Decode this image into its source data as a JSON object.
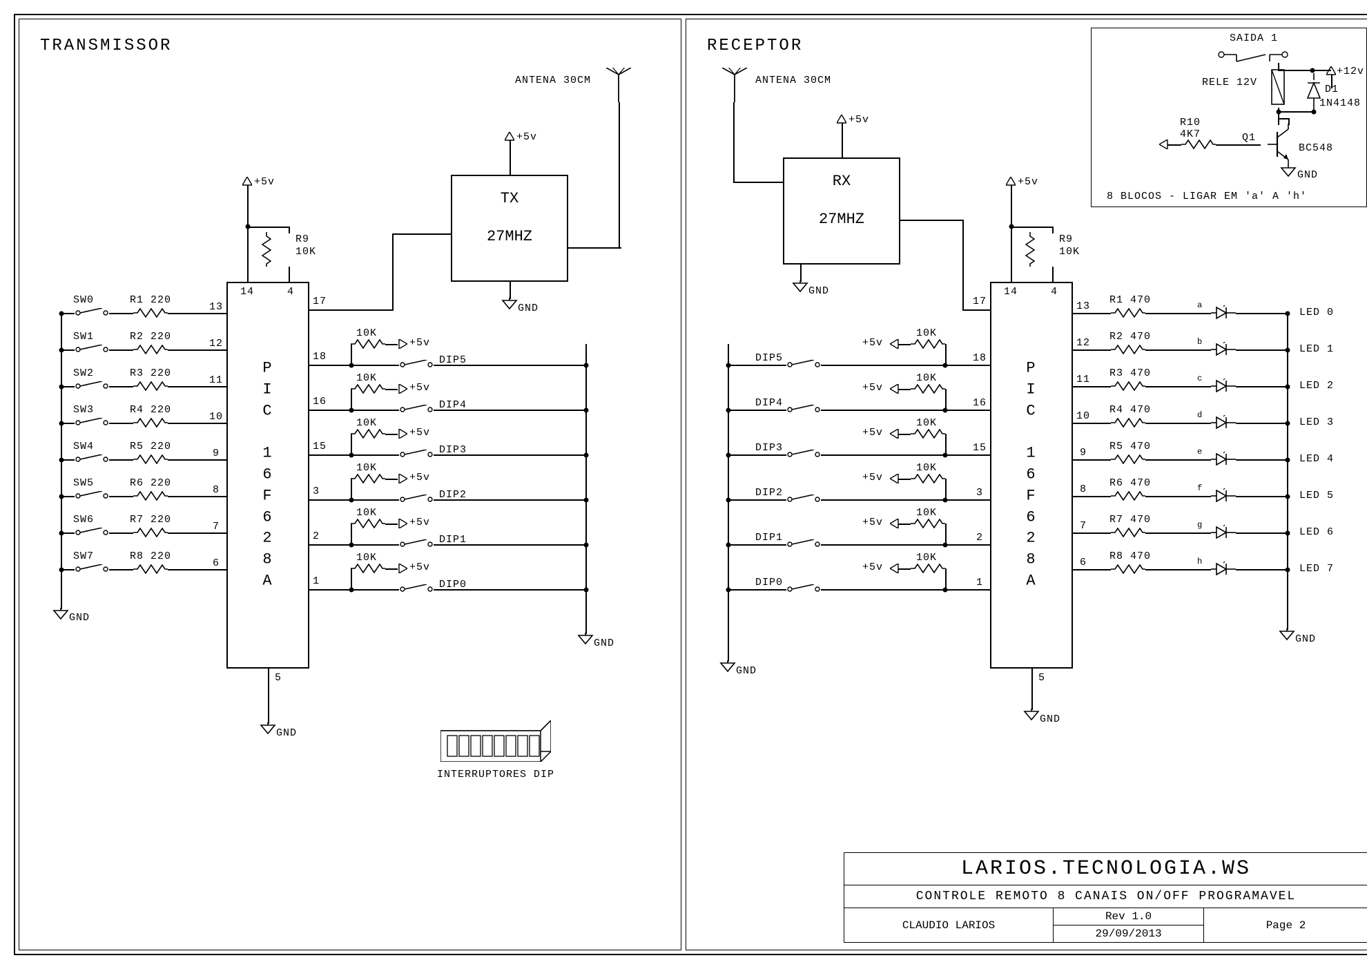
{
  "tx": {
    "title": "TRANSMISSOR",
    "antenna": "ANTENA 30CM",
    "v5": "+5v",
    "r9": "R9",
    "r9v": "10K",
    "module": {
      "line1": "TX",
      "line2": "27MHZ"
    },
    "gnd": "GND",
    "chip": "P\nI\nC\n \n1\n6\nF\n6\n2\n8\nA",
    "pins_left": [
      "13",
      "12",
      "11",
      "10",
      "9",
      "8",
      "7",
      "6"
    ],
    "pins_right_top": [
      "14",
      "4",
      "17"
    ],
    "pins_right_mid": [
      "18",
      "16",
      "15",
      "3",
      "2",
      "1"
    ],
    "pin_bottom": "5",
    "sw": [
      "SW0",
      "SW1",
      "SW2",
      "SW3",
      "SW4",
      "SW5",
      "SW6",
      "SW7"
    ],
    "rin": [
      "R1 220",
      "R2 220",
      "R3 220",
      "R4 220",
      "R5 220",
      "R6 220",
      "R7 220",
      "R8 220"
    ],
    "dip": [
      "DIP5",
      "DIP4",
      "DIP3",
      "DIP2",
      "DIP1",
      "DIP0"
    ],
    "dip_r": "10K",
    "dip_v": "+5v",
    "dip_caption": "INTERRUPTORES DIP"
  },
  "rx": {
    "title": "RECEPTOR",
    "antenna": "ANTENA 30CM",
    "v5": "+5v",
    "r9": "R9",
    "r9v": "10K",
    "module": {
      "line1": "RX",
      "line2": "27MHZ"
    },
    "gnd": "GND",
    "chip": "P\nI\nC\n \n1\n6\nF\n6\n2\n8\nA",
    "pins_right": [
      "13",
      "12",
      "11",
      "10",
      "9",
      "8",
      "7",
      "6"
    ],
    "pins_left_top": [
      "14",
      "4",
      "17"
    ],
    "pins_left_mid": [
      "18",
      "16",
      "15",
      "3",
      "2",
      "1"
    ],
    "pin_bottom": "5",
    "led_r": [
      "R1 470",
      "R2 470",
      "R3 470",
      "R4 470",
      "R5 470",
      "R6 470",
      "R7 470",
      "R8 470"
    ],
    "led_net": [
      "a",
      "b",
      "c",
      "d",
      "e",
      "f",
      "g",
      "h"
    ],
    "leds": [
      "LED 0",
      "LED 1",
      "LED 2",
      "LED 3",
      "LED 4",
      "LED 5",
      "LED 6",
      "LED 7"
    ],
    "dip": [
      "DIP5",
      "DIP4",
      "DIP3",
      "DIP2",
      "DIP1",
      "DIP0"
    ],
    "dip_r": "10K",
    "dip_v": "+5v"
  },
  "relay": {
    "saida": "SAIDA 1",
    "v12": "+12v",
    "rele": "RELE 12V",
    "d1": "D1",
    "dv": "1N4148",
    "r10": "R10",
    "r10v": "4K7",
    "q1": "Q1",
    "qv": "BC548",
    "gnd": "GND",
    "note": "8 BLOCOS - LIGAR EM 'a' A 'h'"
  },
  "tb": {
    "title": "LARIOS.TECNOLOGIA.WS",
    "sub": "CONTROLE REMOTO 8 CANAIS ON/OFF  PROGRAMAVEL",
    "author": "CLAUDIO LARIOS",
    "rev": "Rev 1.0",
    "date": "29/09/2013",
    "page": "Page 2"
  }
}
